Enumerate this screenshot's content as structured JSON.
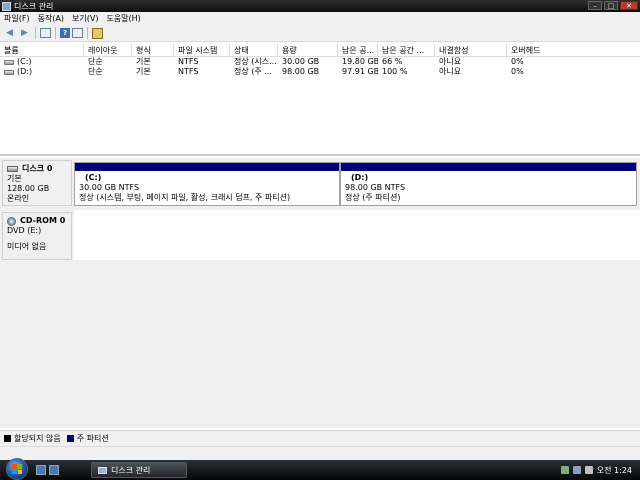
{
  "window": {
    "title": "디스크 관리"
  },
  "menu": {
    "items": [
      "파일(F)",
      "동작(A)",
      "보기(V)",
      "도움말(H)"
    ]
  },
  "volume_list": {
    "columns": [
      "볼륨",
      "레이아웃",
      "형식",
      "파일 시스템",
      "상태",
      "용량",
      "남은 공...",
      "남은 공간 ...",
      "내결함성",
      "오버헤드"
    ],
    "rows": [
      [
        "(C:)",
        "단순",
        "기본",
        "NTFS",
        "정상 (시스...",
        "30.00 GB",
        "19.80 GB",
        "66 %",
        "아니요",
        "0%"
      ],
      [
        "(D:)",
        "단순",
        "기본",
        "NTFS",
        "정상 (주 ...",
        "98.00 GB",
        "97.91 GB",
        "100 %",
        "아니요",
        "0%"
      ]
    ]
  },
  "disk0": {
    "name": "디스크 0",
    "type": "기본",
    "size": "128.00 GB",
    "status": "온라인",
    "partitions": [
      {
        "name": "(C:)",
        "size": "30.00 GB NTFS",
        "status": "정상 (시스템, 부팅, 페이지 파일, 활성, 크래시 덤프, 주 파티션)"
      },
      {
        "name": "(D:)",
        "size": "98.00 GB NTFS",
        "status": "정상 (주 파티션)"
      }
    ]
  },
  "cdrom0": {
    "name": "CD-ROM 0",
    "drive": "DVD (E:)",
    "status": "미디어 없음"
  },
  "legend": {
    "unallocated": "할당되지 않음",
    "primary": "주 파티션"
  },
  "taskbar": {
    "task": "디스크 관리",
    "clock": "오전 1:24"
  },
  "colors": {
    "primary_partition": "#00007f",
    "unallocated": "#000000"
  }
}
